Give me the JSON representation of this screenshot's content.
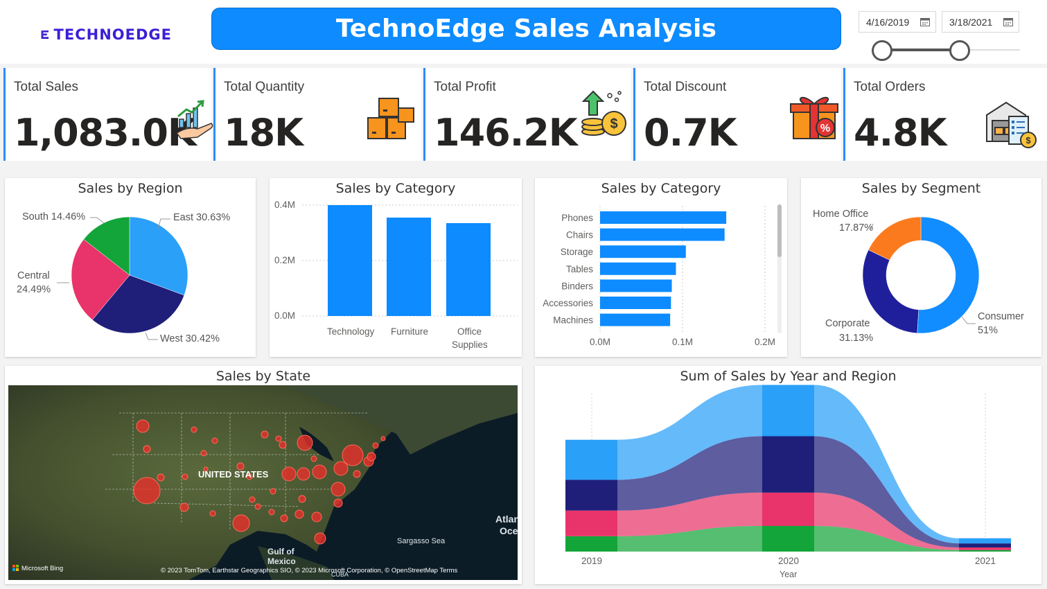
{
  "header": {
    "logo_text": "TECHNOEDGE",
    "title": "TechnoEdge Sales Analysis",
    "date_start": "4/16/2019",
    "date_end": "3/18/2021"
  },
  "kpis": [
    {
      "label": "Total Sales",
      "value": "1,083.0K",
      "icon": "sales-growth-icon"
    },
    {
      "label": "Total Quantity",
      "value": "18K",
      "icon": "boxes-icon"
    },
    {
      "label": "Total Profit",
      "value": "146.2K",
      "icon": "profit-coins-icon"
    },
    {
      "label": "Total Discount",
      "value": "0.7K",
      "icon": "gift-discount-icon"
    },
    {
      "label": "Total Orders",
      "value": "4.8K",
      "icon": "warehouse-orders-icon"
    }
  ],
  "region_pie": {
    "title": "Sales by Region",
    "labels": {
      "south": "South 14.46%",
      "east": "East 30.63%",
      "central_name": "Central",
      "central_pct": "24.49%",
      "west": "West 30.42%"
    }
  },
  "category_bar": {
    "title": "Sales by Category",
    "y_ticks": [
      "0.4M",
      "0.2M",
      "0.0M"
    ],
    "categories": [
      "Technology",
      "Furniture",
      "Office",
      "Supplies"
    ]
  },
  "subcategory_bar": {
    "title": "Sales by Category",
    "x_ticks": [
      "0.0M",
      "0.1M",
      "0.2M"
    ]
  },
  "segment_donut": {
    "title": "Sales by Segment",
    "labels": {
      "home_name": "Home Office",
      "home_pct": "17.87%",
      "consumer_name": "Consumer",
      "consumer_pct": "51%",
      "corporate_name": "Corporate",
      "corporate_pct": "31.13%"
    }
  },
  "map": {
    "title": "Sales by State",
    "labels": {
      "country": "UNITED STATES",
      "gulf1": "Gulf of",
      "gulf2": "Mexico",
      "sea": "Sargasso Sea",
      "ocean1": "Atlan",
      "ocean2": "Oce",
      "cuba": "CUBA"
    },
    "bing": "Microsoft Bing",
    "attribution": "© 2023 TomTom, Earthstar Geographics SIO, © 2023 Microsoft Corporation, © OpenStreetMap  Terms"
  },
  "ribbon": {
    "title": "Sum of Sales by Year and Region",
    "x_ticks": [
      "2019",
      "2020",
      "2021"
    ],
    "xlabel": "Year"
  },
  "colors": {
    "accent": "#0d8bff",
    "east": "#2aa0f8",
    "west": "#1f1f7a",
    "central": "#e8346a",
    "south": "#13a539",
    "consumer": "#118dff",
    "corporate": "#1f1f9c",
    "home_office": "#fc7a1e"
  },
  "chart_data": [
    {
      "type": "pie",
      "title": "Sales by Region",
      "categories": [
        "East",
        "West",
        "Central",
        "South"
      ],
      "values": [
        30.63,
        30.42,
        24.49,
        14.46
      ]
    },
    {
      "type": "bar",
      "title": "Sales by Category",
      "categories": [
        "Technology",
        "Furniture",
        "Office Supplies"
      ],
      "values": [
        0.4,
        0.355,
        0.335
      ],
      "ylabel": "",
      "ylim": [
        0,
        0.4
      ]
    },
    {
      "type": "bar",
      "title": "Sales by Category",
      "orientation": "horizontal",
      "categories": [
        "Phones",
        "Chairs",
        "Storage",
        "Tables",
        "Binders",
        "Accessories",
        "Machines"
      ],
      "values": [
        0.153,
        0.151,
        0.104,
        0.092,
        0.087,
        0.086,
        0.085
      ],
      "xlim": [
        0,
        0.2
      ]
    },
    {
      "type": "pie",
      "title": "Sales by Segment",
      "donut": true,
      "categories": [
        "Consumer",
        "Corporate",
        "Home Office"
      ],
      "values": [
        51,
        31.13,
        17.87
      ]
    },
    {
      "type": "area",
      "title": "Sum of Sales by Year and Region",
      "xlabel": "Year",
      "categories": [
        "2019",
        "2020",
        "2021"
      ],
      "series": [
        {
          "name": "South",
          "values": [
            30,
            50,
            3
          ]
        },
        {
          "name": "Central",
          "values": [
            50,
            65,
            5
          ]
        },
        {
          "name": "West",
          "values": [
            60,
            110,
            8
          ]
        },
        {
          "name": "East",
          "values": [
            78,
            100,
            10
          ]
        }
      ]
    }
  ]
}
